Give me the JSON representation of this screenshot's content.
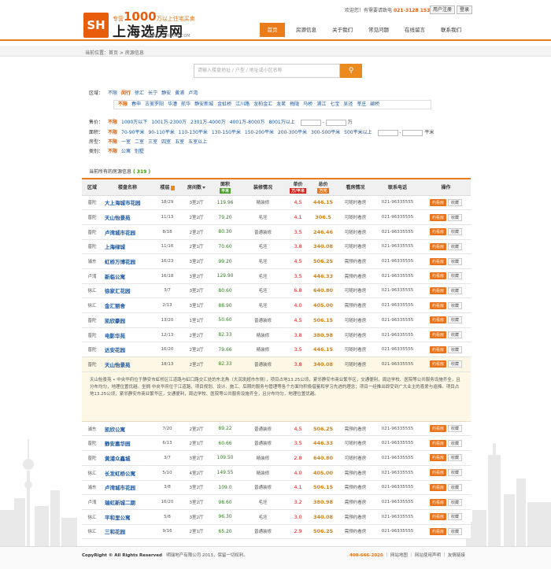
{
  "header": {
    "logo_mark": "SH",
    "tag_prefix": "专营",
    "tag_number": "1000",
    "tag_suffix": "万以上住宅买卖",
    "site_name": "上海选房网",
    "site_url": "WWW.SH-HOUSE.COM",
    "welcome": "欢迎您！有需要请致电",
    "phone": "021-3128 1536",
    "register": "用户注册",
    "login": "登录",
    "nav": [
      "首页",
      "房源信息",
      "关于我们",
      "常见问题",
      "在线留言",
      "联系我们"
    ]
  },
  "breadcrumb": "当前位置：首页 > 房源信息",
  "search": {
    "placeholder": "请输入楼盘地址 / 户型 / 地址或小区名称",
    "button_icon": "search-icon"
  },
  "filters": {
    "area_label": "区域：",
    "areas": [
      "不限",
      "闵行",
      "徐汇",
      "长宁",
      "静安",
      "黄浦",
      "卢湾"
    ],
    "subareas": [
      "不限",
      "春申",
      "古美罗阳",
      "华漕",
      "航华",
      "静安新城",
      "金虹桥",
      "江川路",
      "龙柏金汇",
      "龙茗",
      "梅陇",
      "马桥",
      "浦江",
      "七宝",
      "吴泾",
      "莘庄",
      "颛桥"
    ],
    "price_label": "售价：",
    "prices": [
      "不限",
      "1000万以下",
      "1001万-2300万",
      "2301万-4000万",
      "4001万-8000万",
      "8001万以上"
    ],
    "price_unit": "万",
    "size_label": "面积：",
    "sizes": [
      "不限",
      "70-90平米",
      "90-110平米",
      "110-130平米",
      "130-150平米",
      "150-200平米",
      "200-300平米",
      "300-500平米",
      "500平米以上"
    ],
    "size_unit": "平米",
    "room_label": "房型：",
    "rooms": [
      "不限",
      "一室",
      "二室",
      "三室",
      "四室",
      "五室",
      "五室以上"
    ],
    "type_label": "类别：",
    "types": [
      "不限",
      "公寓",
      "别墅"
    ]
  },
  "count": {
    "label": "当前所有的房源信息",
    "value": "( 319 )"
  },
  "table": {
    "headers": {
      "district": "区域",
      "name": "楼盘名称",
      "floor": "楼层",
      "layout": "房间数",
      "area": "面积",
      "area_unit": "平米",
      "decor": "装修情况",
      "unit_price": "单价",
      "unit_price_unit": "万/平米",
      "total": "总价",
      "total_unit": "万元",
      "view": "看房情况",
      "phone": "联系电话",
      "action": "操作"
    },
    "book_label": "约看房",
    "fav_label": "收藏",
    "rows_top": [
      {
        "district": "普陀",
        "name": "大上海城市花园",
        "floor": "18/29",
        "layout": "3室2厅",
        "area": "119.96",
        "decor": "精装修",
        "price": "4.5",
        "total": "446.15",
        "view": "可随时看房",
        "phone": "021-96335555"
      },
      {
        "district": "普陀",
        "name": "天山怡景苑",
        "floor": "11/13",
        "layout": "2室2厅",
        "area": "79.20",
        "decor": "毛坯",
        "price": "4.1",
        "total": "306.5",
        "view": "可随时看房",
        "phone": "021-96335555"
      },
      {
        "district": "普陀",
        "name": "卢湾城市花园",
        "floor": "8/18",
        "layout": "2室2厅",
        "area": "80.30",
        "decor": "普通装修",
        "price": "3.5",
        "total": "246.46",
        "view": "可随时看房",
        "phone": "021-96335555"
      },
      {
        "district": "普陀",
        "name": "上海绿城",
        "floor": "11/16",
        "layout": "2室1厅",
        "area": "70.60",
        "decor": "毛坯",
        "price": "3.8",
        "total": "340.08",
        "view": "可随时看房",
        "phone": "021-96335555"
      },
      {
        "district": "浦东",
        "name": "虹桥万博花园",
        "floor": "16/23",
        "layout": "3室2厅",
        "area": "99.20",
        "decor": "毛坯",
        "price": "4.5",
        "total": "506.25",
        "view": "需预约看房",
        "phone": "021-96335555"
      },
      {
        "district": "卢湾",
        "name": "新临公寓",
        "floor": "16/18",
        "layout": "3室2厅",
        "area": "129.90",
        "decor": "毛坯",
        "price": "3.5",
        "total": "446.33",
        "view": "需预约看房",
        "phone": "021-96335555"
      },
      {
        "district": "徐汇",
        "name": "徐家汇花园",
        "floor": "3/7",
        "layout": "3室2厅",
        "area": "80.60",
        "decor": "毛坯",
        "price": "6.8",
        "total": "640.80",
        "view": "可随时看房",
        "phone": "021-96335555"
      },
      {
        "district": "徐汇",
        "name": "金汇丽舍",
        "floor": "2/13",
        "layout": "3室1厅",
        "area": "88.90",
        "decor": "毛坯",
        "price": "4.0",
        "total": "405.00",
        "view": "需预约看房",
        "phone": "021-96335555"
      },
      {
        "district": "普陀",
        "name": "凯欣豪园",
        "floor": "13/20",
        "layout": "1室1厅",
        "area": "50.60",
        "decor": "普通装修",
        "price": "4.5",
        "total": "506.15",
        "view": "可随时看房",
        "phone": "021-96335555"
      },
      {
        "district": "普陀",
        "name": "电影华苑",
        "floor": "12/13",
        "layout": "2室2厅",
        "area": "82.33",
        "decor": "精装修",
        "price": "3.8",
        "total": "380.98",
        "view": "可随时看房",
        "phone": "021-96335555"
      },
      {
        "district": "普陀",
        "name": "达安花园",
        "floor": "16/20",
        "layout": "2室2厅",
        "area": "79.66",
        "decor": "精装修",
        "price": "3.5",
        "total": "446.15",
        "view": "可随时看房",
        "phone": "021-96335555"
      },
      {
        "district": "普陀",
        "name": "天山怡景苑",
        "floor": "18/13",
        "layout": "2室2厅",
        "area": "82.33",
        "decor": "普通装修",
        "price": "3.8",
        "total": "340.08",
        "view": "可随时看房",
        "phone": "021-96335555"
      }
    ],
    "detail": "天山怡景苑 • 中央华府位于静安市虹桥区江道路与虹口路交汇处的东北角（大润发超市东侧），项目占地13.25公顷，紧邻静安市商业繁华区，交通便利，周边学校、医院等公共服务设施齐全，且分布均匀，地理位置优越。坐拥 中央华府位于江道路，项目规划、设计、施工、后期的服务与管理等各个方面均积极借鉴和学习先进的理念；项目一经推出即受到广大业主的喜爱与追捧。项目占地13.25公顷，紧邻静安市商业繁华区，交通便利，周边学校、医院等公共服务设施齐全，且分布均匀，地理位置优越。",
    "rows_bottom": [
      {
        "district": "浦东",
        "name": "凯欣公寓",
        "floor": "7/20",
        "layout": "2室2厅",
        "area": "89.22",
        "decor": "普通装修",
        "price": "4.5",
        "total": "506.25",
        "view": "需预约看房",
        "phone": "021-96335555"
      },
      {
        "district": "普陀",
        "name": "静安嘉华园",
        "floor": "6/13",
        "layout": "2室1厅",
        "area": "60.66",
        "decor": "普通装修",
        "price": "3.5",
        "total": "446.33",
        "view": "可随时看房",
        "phone": "021-96335555"
      },
      {
        "district": "普陀",
        "name": "黄浦众鑫城",
        "floor": "3/7",
        "layout": "3室2厅",
        "area": "109.50",
        "decor": "精装修",
        "price": "2.8",
        "total": "640.80",
        "view": "可随时看房",
        "phone": "021-96335555"
      },
      {
        "district": "徐汇",
        "name": "长发虹桥公寓",
        "floor": "5/10",
        "layout": "4室2厅",
        "area": "149.55",
        "decor": "精装修",
        "price": "4.0",
        "total": "405.00",
        "view": "需预约看房",
        "phone": "021-96335555"
      },
      {
        "district": "浦东",
        "name": "卢湾城市花园",
        "floor": "3/8",
        "layout": "3室2厅",
        "area": "109.0",
        "decor": "普通装修",
        "price": "4.1",
        "total": "506.15",
        "view": "需预约看房",
        "phone": "021-96335555"
      },
      {
        "district": "卢湾",
        "name": "瑞虹新城二期",
        "floor": "16/20",
        "layout": "3室2厅",
        "area": "98.60",
        "decor": "毛坯",
        "price": "3.2",
        "total": "380.98",
        "view": "需预约看房",
        "phone": "021-96335555"
      },
      {
        "district": "徐汇",
        "name": "平和里公寓",
        "floor": "5/8",
        "layout": "3室2厅",
        "area": "96.30",
        "decor": "毛坯",
        "price": "3.0",
        "total": "340.08",
        "view": "需预约看房",
        "phone": "021-96335555"
      },
      {
        "district": "徐汇",
        "name": "三和花园",
        "floor": "9/16",
        "layout": "2室1厅",
        "area": "65.20",
        "decor": "普通装修",
        "price": "2.9",
        "total": "506.25",
        "view": "需预约看房",
        "phone": "021-96335555"
      }
    ]
  },
  "footer": {
    "copy_brand": "CopyRight © All Rights Reserved",
    "copy_rest": "明瑞地产有限公司 2013，保留一切权利。",
    "phone": "400-666-2020",
    "links": [
      "网站地图",
      "网站使用声明",
      "友情链接"
    ]
  },
  "colors": {
    "accent": "#ea7c1b",
    "link": "#1a57a3",
    "price": "#d22222",
    "total": "#d8820b",
    "area": "#2f7f1f"
  }
}
